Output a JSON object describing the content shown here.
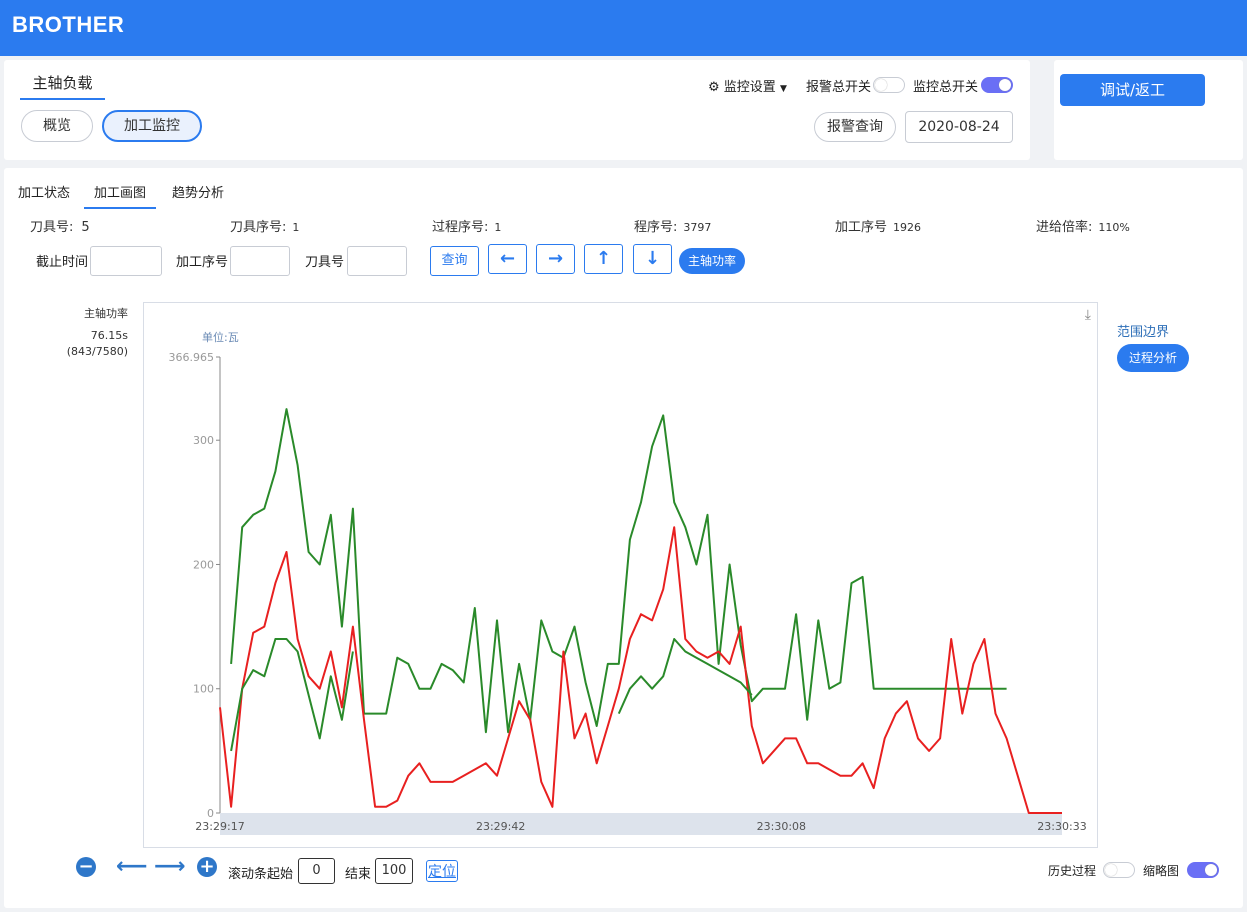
{
  "header": {
    "brand": "BROTHER"
  },
  "top": {
    "title_tab": "主轴负载",
    "nav_overview": "概览",
    "nav_monitor": "加工监控",
    "monitor_settings": "监控设置",
    "alarm_switch_label": "报警总开关",
    "monitor_switch_label": "监控总开关",
    "alarm_switch_on": false,
    "monitor_switch_on": true,
    "alarm_query": "报警查询",
    "date": "2020-08-24",
    "debug_button": "调试/返工"
  },
  "tabs": [
    "加工状态",
    "加工画图",
    "趋势分析"
  ],
  "info": {
    "tool_no_label": "刀具号:",
    "tool_no": "5",
    "tool_seq_label": "刀具序号:",
    "tool_seq": "1",
    "proc_seq_label": "过程序号:",
    "proc_seq": "1",
    "prog_label": "程序号:",
    "prog": "3797",
    "mach_seq_label": "加工序号",
    "mach_seq": "1926",
    "feed_label": "进给倍率:",
    "feed": "110%"
  },
  "filters": {
    "cutoff_label": "截止时间",
    "mach_seq_label": "加工序号",
    "tool_label": "刀具号",
    "query_button": "查询",
    "spindle_button": "主轴功率"
  },
  "side": {
    "series_label": "主轴功率",
    "time": "76.15s",
    "position": "(843/7580)",
    "range_label": "范围边界",
    "process_button": "过程分析"
  },
  "chart_data": {
    "type": "line",
    "unit_label": "单位:瓦",
    "ylim": [
      0,
      366.965
    ],
    "y_ticks": [
      "0",
      "100",
      "200",
      "300",
      "366.965"
    ],
    "x_ticks": [
      "23:29:17",
      "23:29:42",
      "23:30:08",
      "23:30:33"
    ],
    "colors": {
      "upper": "#2a8a2a",
      "mid": "#e82020",
      "lower": "#2a8a2a"
    },
    "t": [
      0,
      1,
      2,
      3,
      4,
      5,
      6,
      7,
      8,
      9,
      10,
      11,
      12,
      13,
      14,
      15,
      16,
      17,
      18,
      19,
      20,
      21,
      22,
      23,
      24,
      25,
      26,
      27,
      28,
      29,
      30,
      31,
      32,
      33,
      34,
      35,
      36,
      37,
      38,
      39,
      40,
      41,
      42,
      43,
      44,
      45,
      46,
      47,
      48,
      49,
      50,
      51,
      52,
      53,
      54,
      55,
      56,
      57,
      58,
      59,
      60,
      61,
      62,
      63,
      64,
      65,
      66,
      67,
      68,
      69,
      70,
      71,
      72,
      73,
      74,
      75,
      76
    ],
    "series": [
      {
        "values": [
          null,
          120,
          230,
          240,
          245,
          275,
          325,
          280,
          210,
          200,
          240,
          150,
          245,
          80,
          80,
          80,
          125,
          120,
          100,
          100,
          120,
          115,
          105,
          165,
          65,
          155,
          65,
          120,
          75,
          155,
          130,
          125,
          150,
          105,
          70,
          120,
          120,
          220,
          250,
          295,
          320,
          250,
          230,
          200,
          240,
          120,
          200,
          135,
          90,
          100,
          100,
          100,
          160,
          75,
          155,
          100,
          105,
          185,
          190,
          100,
          100,
          100,
          100,
          100,
          100,
          100,
          100,
          100,
          100,
          100,
          100,
          100,
          null,
          null,
          null,
          null,
          null
        ]
      },
      {
        "values": [
          85,
          5,
          100,
          145,
          150,
          185,
          210,
          140,
          110,
          100,
          130,
          85,
          150,
          75,
          5,
          5,
          10,
          30,
          40,
          25,
          25,
          25,
          30,
          35,
          40,
          30,
          60,
          90,
          75,
          25,
          5,
          130,
          60,
          80,
          40,
          70,
          100,
          140,
          160,
          155,
          180,
          230,
          140,
          130,
          125,
          130,
          120,
          150,
          70,
          40,
          50,
          60,
          60,
          40,
          40,
          35,
          30,
          30,
          40,
          20,
          60,
          80,
          90,
          60,
          50,
          60,
          140,
          80,
          120,
          140,
          80,
          60,
          30,
          0,
          0,
          0,
          0
        ]
      },
      {
        "values": [
          null,
          50,
          100,
          115,
          110,
          140,
          140,
          130,
          95,
          60,
          110,
          75,
          130,
          null,
          null,
          null,
          null,
          null,
          null,
          null,
          null,
          null,
          null,
          null,
          null,
          null,
          null,
          null,
          null,
          null,
          null,
          null,
          null,
          null,
          null,
          null,
          80,
          100,
          110,
          100,
          110,
          140,
          130,
          125,
          120,
          115,
          110,
          105,
          95,
          null,
          null,
          null,
          null,
          null,
          null,
          null,
          null,
          null,
          null,
          null,
          null,
          null,
          null,
          null,
          null,
          null,
          null,
          null,
          null,
          null,
          null,
          null,
          null,
          null,
          null,
          null,
          null
        ]
      }
    ]
  },
  "bottom": {
    "scroll_start_label": "滚动条起始",
    "scroll_start": "0",
    "end_label": "结束",
    "end": "100",
    "locate": "定位",
    "history_label": "历史过程",
    "thumbnail_label": "缩略图"
  }
}
